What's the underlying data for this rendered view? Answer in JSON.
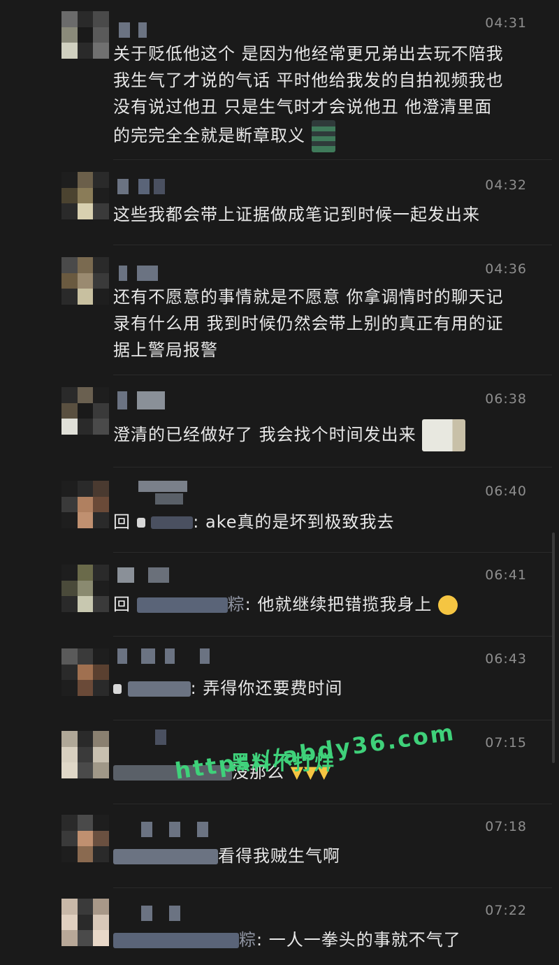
{
  "messages": [
    {
      "time": "04:31",
      "text_lines": [
        "关于贬低他这个 是因为他经常更兄弟出去玩不陪我",
        "我生气了才说的气话 平时他给我发的自拍视频我也",
        "没有说过他丑 只是生气时才会说他丑 他澄清里面",
        "的完完全全就是断章取义"
      ]
    },
    {
      "time": "04:32",
      "text_lines": [
        "这些我都会带上证据做成笔记到时候一起发出来"
      ]
    },
    {
      "time": "04:36",
      "text_lines": [
        "还有不愿意的事情就是不愿意 你拿调情时的聊天记",
        "录有什么用 我到时候仍然会带上别的真正有用的证",
        "据上警局报警"
      ]
    },
    {
      "time": "06:38",
      "text_lines": [
        "澄清的已经做好了 我会找个时间发出来"
      ]
    },
    {
      "time": "06:40",
      "prefix": "回",
      "text": ": ake真的是坏到极致我去"
    },
    {
      "time": "06:41",
      "prefix": "回",
      "suffix": "粽",
      "text": ": 他就继续把错揽我身上"
    },
    {
      "time": "06:43",
      "text": ": 弄得你还要费时间"
    },
    {
      "time": "07:15",
      "text": "没那么"
    },
    {
      "time": "07:18",
      "text": "看得我贼生气啊"
    },
    {
      "time": "07:22",
      "suffix": "粽",
      "text": ": 一人一拳头的事就不气了"
    }
  ],
  "watermark": {
    "line1": "黑料不打烊",
    "line2": "https://abdy36.com"
  },
  "colors": {
    "background": "#1a1a1a",
    "text": "#e8e8e8",
    "time": "#8e8e8e",
    "watermark": "#3fd17a"
  }
}
